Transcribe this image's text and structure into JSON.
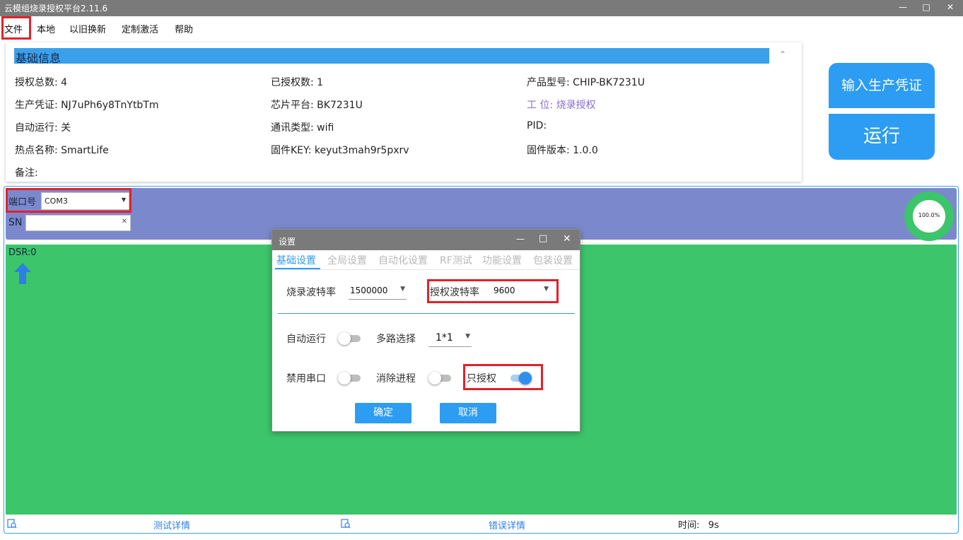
{
  "window": {
    "title": "云模组烧录授权平台2.11.6"
  },
  "menu": [
    "文件",
    "本地",
    "以旧换新",
    "定制激活",
    "帮助"
  ],
  "info": {
    "header": "基础信息",
    "fields": {
      "auth_total": "授权总数: 4",
      "authorized": "已授权数: 1",
      "product_model": "产品型号: CHIP-BK7231U",
      "prod_token": "生产凭证: NJ7uPh6y8TnYtbTm",
      "chip_platform": "芯片平台: BK7231U",
      "workstation": "工 位: 烧录授权",
      "auto_run": "自动运行: 关",
      "comm_type": "通讯类型: wifi",
      "pid": "PID:",
      "hotspot": "热点名称: SmartLife",
      "fw_key": "固件KEY: keyut3mah9r5pxrv",
      "fw_version": "固件版本: 1.0.0",
      "remark": "备注:"
    }
  },
  "actions": {
    "enter_token": "输入生产凭证",
    "run": "运行"
  },
  "port": {
    "label": "端口号",
    "value": "COM3",
    "sn_label": "SN",
    "sn_value": ""
  },
  "progress": {
    "text": "100.0%",
    "fraction": 1.0
  },
  "status": {
    "dsr": "DSR:0"
  },
  "bottom": {
    "test_details": "测试详情",
    "error_details": "错误详情",
    "time": "时间:   9s"
  },
  "dialog": {
    "title": "设置",
    "tabs": [
      "基础设置",
      "全局设置",
      "自动化设置",
      "RF测试",
      "功能设置",
      "包装设置"
    ],
    "burn_baud_label": "烧录波特率",
    "burn_baud_value": "1500000",
    "auth_baud_label": "授权波特率",
    "auth_baud_value": "9600",
    "auto_run_label": "自动运行",
    "multi_label": "多路选择",
    "multi_value": "1*1",
    "disable_serial_label": "禁用串口",
    "kill_process_label": "消除进程",
    "auth_only_label": "只授权",
    "ok": "确定",
    "cancel": "取消"
  },
  "colors": {
    "accent": "#2d9cf3",
    "port_bar": "#7b89cc",
    "green": "#3cc56a",
    "highlight": "#e5202a"
  }
}
